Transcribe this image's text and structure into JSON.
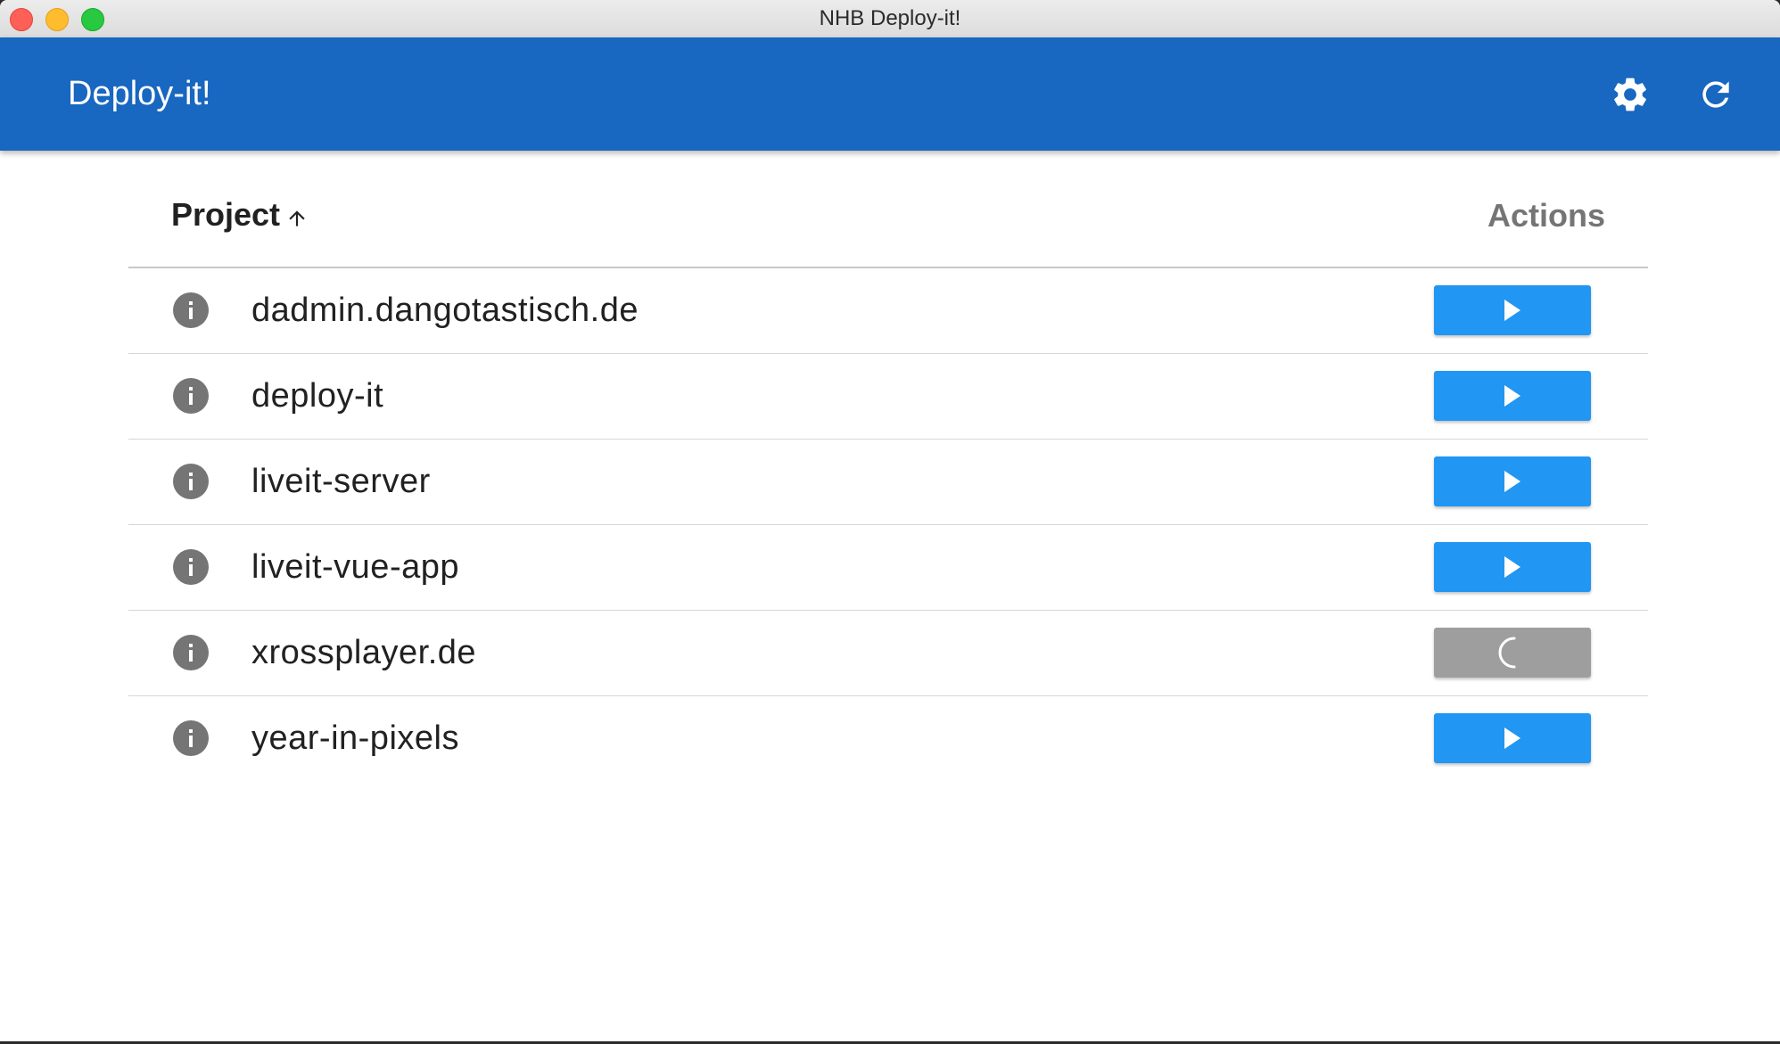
{
  "window": {
    "title": "NHB Deploy-it!"
  },
  "appbar": {
    "title": "Deploy-it!",
    "actions": [
      {
        "name": "settings",
        "icon": "gear-icon"
      },
      {
        "name": "refresh",
        "icon": "refresh-icon"
      }
    ]
  },
  "table": {
    "columns": {
      "project": "Project",
      "actions": "Actions"
    },
    "sort": {
      "column": "project",
      "direction": "ascending",
      "icon": "arrow-up-icon"
    },
    "rows": [
      {
        "name": "dadmin.dangotastisch.de",
        "status": "idle"
      },
      {
        "name": "deploy-it",
        "status": "idle"
      },
      {
        "name": "liveit-server",
        "status": "idle"
      },
      {
        "name": "liveit-vue-app",
        "status": "idle"
      },
      {
        "name": "xrossplayer.de",
        "status": "deploying"
      },
      {
        "name": "year-in-pixels",
        "status": "idle"
      }
    ]
  },
  "colors": {
    "appbar": "#1867c0",
    "deploy_button": "#2196f3",
    "deploy_button_loading": "#9e9e9e",
    "info_icon": "#757575"
  }
}
